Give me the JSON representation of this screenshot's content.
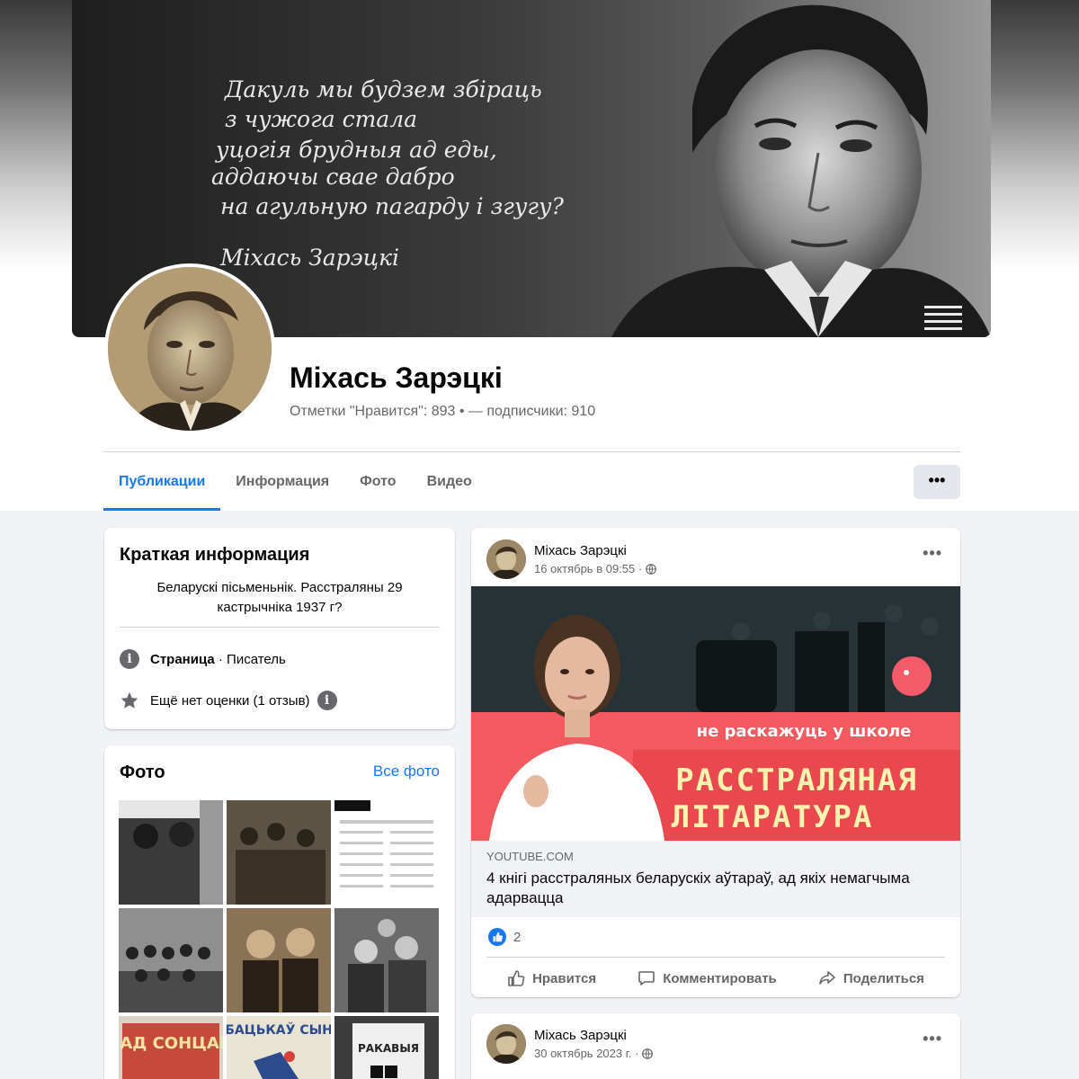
{
  "page": {
    "name": "Міхась Зарэцкі",
    "stats": "Отметки \"Нравится\": 893 • — подписчики: 910",
    "cover_quote": [
      "Дакуль мы будзем збіраць",
      "з чужога стала",
      "уцогія брудныя ад еды,",
      "аддаючы свае дабро",
      "на агульную пагарду і згугу?",
      "Міхась Зарэцкі"
    ]
  },
  "tabs": [
    "Публикации",
    "Информация",
    "Фото",
    "Видео"
  ],
  "more_label": "•••",
  "intro": {
    "title": "Краткая информация",
    "bio": "Беларускі пісьменьнік. Расстраляны 29 кастрычніка 1937 г?",
    "page_type_bold": "Страница",
    "page_type_rest": " · Писатель",
    "rating": "Ещё нет оценки (1 отзыв)"
  },
  "photos": {
    "title": "Фото",
    "see_all": "Все фото",
    "book_titles": [
      "ПАД СОНЦАМ",
      "БАЦЬКАЎ СЫН",
      "РАКАВЫЯ"
    ]
  },
  "post1": {
    "author": "Міхась Зарэцкі",
    "time": "16 октябрь в 09:55 ·",
    "thumb_subtitle": "не раскажуць у школе",
    "thumb_title_1": "РАССТРАЛЯНАЯ",
    "thumb_title_2": "ЛІТАРАТУРА",
    "domain": "YOUTUBE.COM",
    "link_title": "4 кнігі расстраляных беларускіх аўтараў, ад якіх немагчыма адарвацца",
    "reaction_count": "2",
    "actions": [
      "Нравится",
      "Комментировать",
      "Поделиться"
    ]
  },
  "post2": {
    "author": "Міхась Зарэцкі",
    "time": "30 октябрь 2023 г. ·"
  },
  "colors": {
    "accent": "#1877f2",
    "banner_red": "#f25a5f"
  }
}
